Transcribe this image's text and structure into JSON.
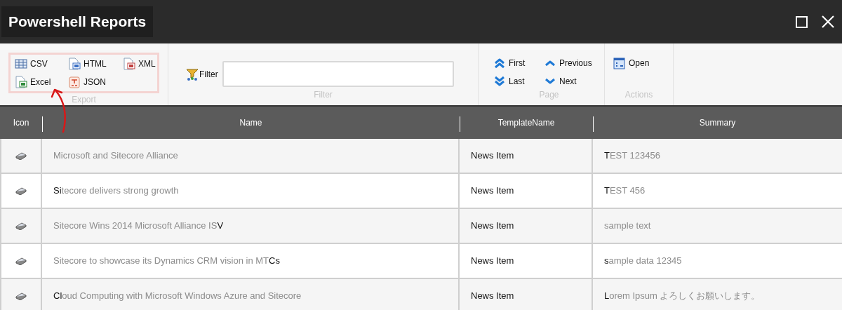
{
  "window": {
    "title": "Powershell Reports"
  },
  "ribbon": {
    "export": {
      "label": "Export",
      "highlighted": true,
      "buttons": [
        "CSV",
        "HTML",
        "XML",
        "Excel",
        "JSON"
      ]
    },
    "filter": {
      "label": "Filter",
      "field_label": "Filter"
    },
    "page": {
      "label": "Page",
      "buttons": [
        "First",
        "Previous",
        "Last",
        "Next"
      ]
    },
    "actions": {
      "label": "Actions",
      "buttons": [
        "Open"
      ]
    }
  },
  "table": {
    "columns": [
      "Icon",
      "Name",
      "TemplateName",
      "Summary"
    ],
    "rows": [
      {
        "name": {
          "faded": "Microsoft and Sitecore Alliance"
        },
        "template": "News Item",
        "summary": {
          "shown": "T",
          "faded": "EST 123456"
        }
      },
      {
        "name": {
          "shown": "Si",
          "faded": "tecore delivers strong growth"
        },
        "template": "News Item",
        "summary": {
          "shown": "T",
          "faded": "EST 456"
        }
      },
      {
        "name": {
          "faded": "Sitecore Wins 2014 Microsoft Alliance IS",
          "after": "V"
        },
        "template": "News Item",
        "summary": {
          "faded": "sample text"
        }
      },
      {
        "name": {
          "faded": "Sitecore to showcase its Dynamics CRM vision in MT",
          "after": "Cs"
        },
        "template": "News Item",
        "summary": {
          "shown": "s",
          "faded": "ample data 12345"
        }
      },
      {
        "name": {
          "shown": "Cl",
          "faded": "oud Computing with Microsoft Windows Azure and Sitecore"
        },
        "template": "News Item",
        "summary": {
          "shown": "L",
          "faded": "orem Ipsum よろしくお願いします。"
        }
      }
    ]
  }
}
